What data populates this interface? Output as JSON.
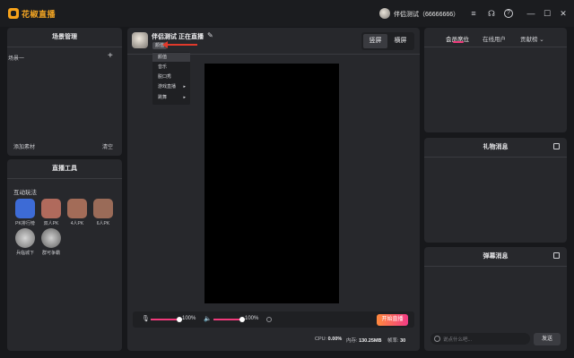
{
  "app": {
    "title": "花椒直播"
  },
  "user": {
    "name": "伴侣测试（66666666）"
  },
  "window_controls": {
    "menu": "≡",
    "headset": "☊",
    "help": "?",
    "minimize": "—",
    "maximize": "☐",
    "close": "✕"
  },
  "scene_panel": {
    "title": "场景管理",
    "scene": "场景一",
    "add_icon": "+",
    "add_material": "添加素材",
    "clear": "清空"
  },
  "tools_panel": {
    "title": "直播工具",
    "interact_label": "互动玩法",
    "tools": [
      {
        "label": "PK排行榜",
        "color": "#3d6bd6"
      },
      {
        "label": "双人PK",
        "color": "#b06a5c"
      },
      {
        "label": "4人PK",
        "color": "#a36c58"
      },
      {
        "label": "6人PK",
        "color": "#9a6b58"
      },
      {
        "label": "兵临城下",
        "color": "#8a8a8a"
      },
      {
        "label": "群可争霸",
        "color": "#7a7a7a"
      }
    ]
  },
  "center": {
    "room_title": "伴侣测试 正在直播",
    "edit_icon": "✎",
    "category_tag": "颜值",
    "dropdown": [
      {
        "label": "颜值",
        "active": true,
        "sub": false
      },
      {
        "label": "音乐",
        "active": false,
        "sub": false
      },
      {
        "label": "脱口秀",
        "active": false,
        "sub": false
      },
      {
        "label": "游戏直播",
        "active": false,
        "sub": true
      },
      {
        "label": "跳舞",
        "active": false,
        "sub": true
      }
    ],
    "orientation": {
      "portrait": "竖屏",
      "landscape": "横屏",
      "selected": "portrait"
    },
    "mic": {
      "icon": "🎙",
      "percent": "100%",
      "level": 1.0
    },
    "speaker": {
      "icon": "🔈",
      "percent": "100%",
      "level": 1.0
    },
    "go_live": "开始直播",
    "stats": {
      "cpu_label": "CPU:",
      "cpu": "0.00%",
      "mem_label": "内存:",
      "mem": "130.25MB",
      "fps_label": "帧率:",
      "fps": "30"
    }
  },
  "right": {
    "tabs": [
      {
        "label": "会员席位"
      },
      {
        "label": "在线用户"
      },
      {
        "label": "贡献榜 ⌄"
      }
    ],
    "gift_title": "礼物消息",
    "danmu_title": "弹幕消息",
    "chat_placeholder": "说点什么吧...",
    "send": "发送"
  }
}
